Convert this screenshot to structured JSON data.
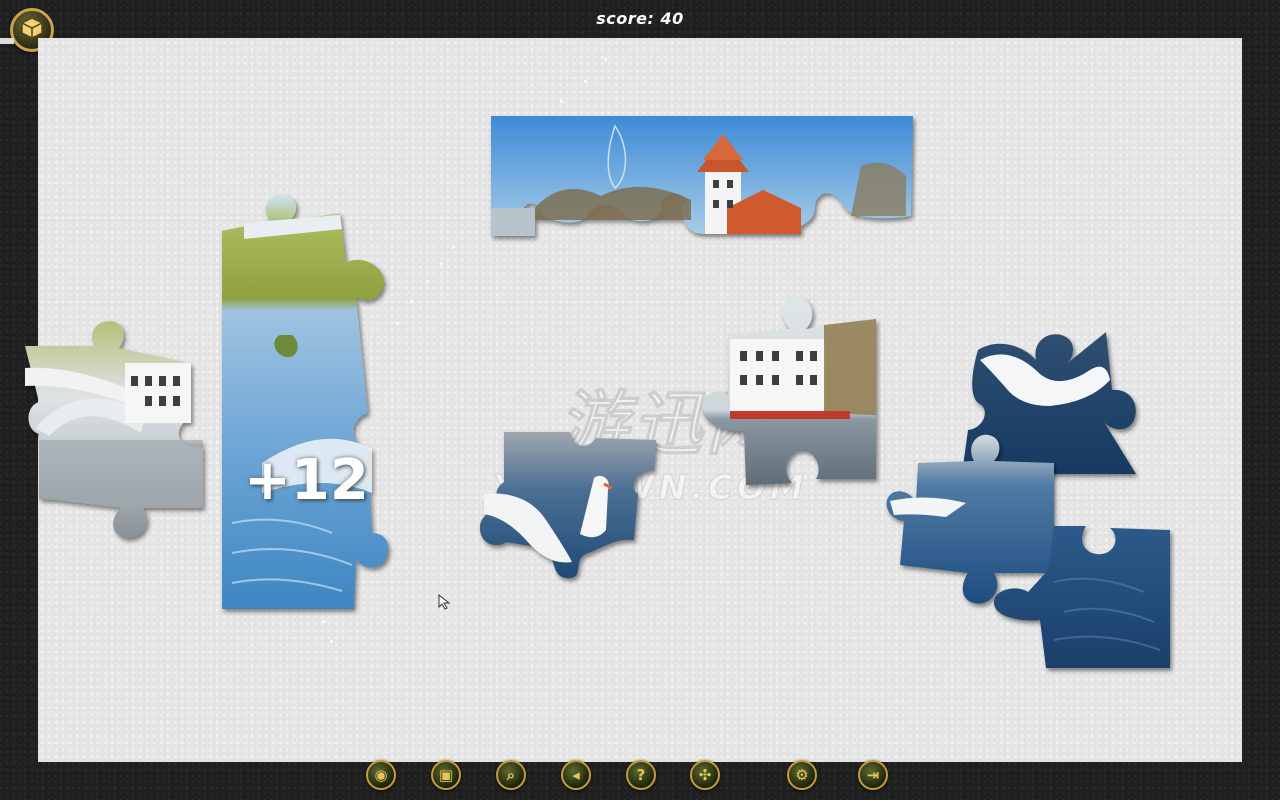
{
  "header": {
    "score_label": "score:",
    "score_value": "40"
  },
  "board": {
    "watermark_text": "游迅网",
    "watermark_sub": "YXDOWN.COM",
    "bonus_text": "+12"
  },
  "pieces": [
    {
      "id": "piece-bridge",
      "scene": "bridge and white house"
    },
    {
      "id": "piece-river-tall",
      "scene": "river with trees"
    },
    {
      "id": "piece-tower-strip",
      "scene": "tower with red roof and blue sky"
    },
    {
      "id": "piece-swans",
      "scene": "swans on water"
    },
    {
      "id": "piece-white-house",
      "scene": "white house by water"
    },
    {
      "id": "piece-swan-right",
      "scene": "swan on dark water"
    },
    {
      "id": "piece-water-mid",
      "scene": "water with reflection"
    },
    {
      "id": "piece-water-bottom",
      "scene": "dark blue water"
    }
  ],
  "toolbar": {
    "buttons": [
      {
        "name": "preview-eye-icon",
        "glyph": "◉"
      },
      {
        "name": "picture-icon",
        "glyph": "▣"
      },
      {
        "name": "magnifier-icon",
        "glyph": "⌕"
      },
      {
        "name": "back-arrow-icon",
        "glyph": "◂"
      },
      {
        "name": "help-icon",
        "glyph": "?"
      },
      {
        "name": "shuffle-pieces-icon",
        "glyph": "✣"
      },
      {
        "name": "settings-gear-icon",
        "glyph": "⚙"
      },
      {
        "name": "exit-door-icon",
        "glyph": "⇥"
      }
    ]
  },
  "colors": {
    "accent": "#c79a3a",
    "board": "#e6e6e6",
    "frame": "#1f1f1f"
  }
}
